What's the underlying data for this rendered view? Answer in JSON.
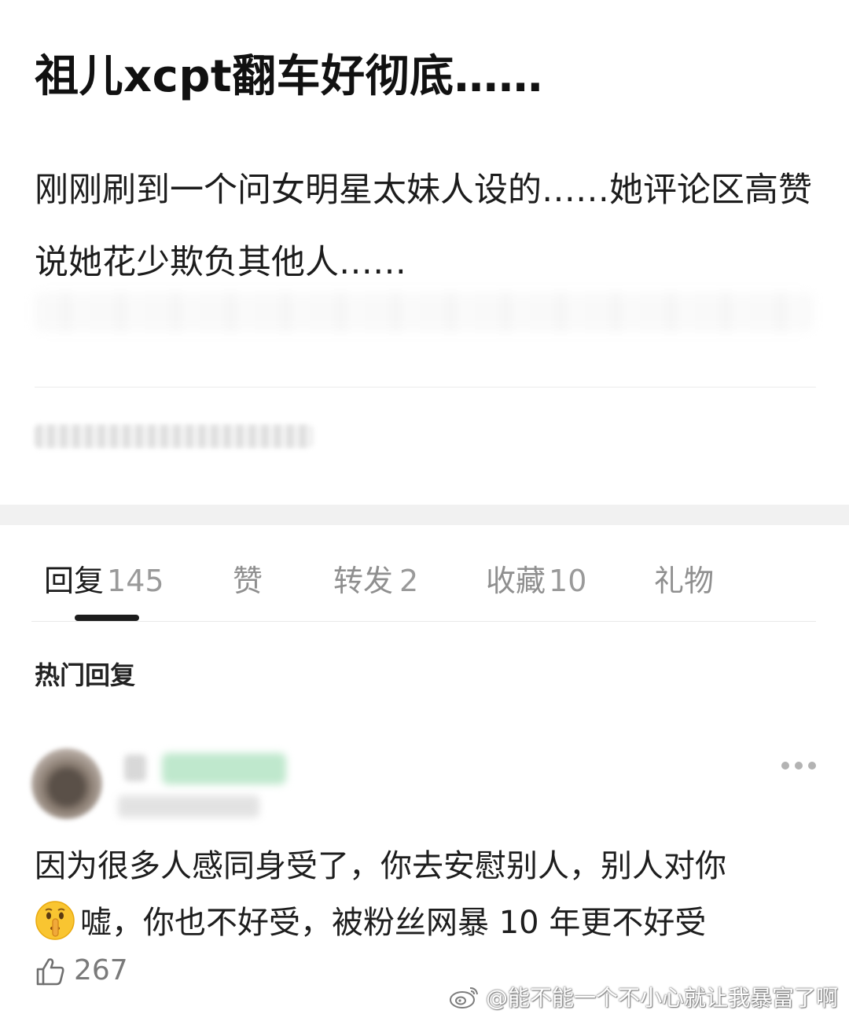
{
  "post": {
    "title": "祖儿xcpt翻车好彻底……",
    "body": "刚刚刷到一个问女明星太妹人设的……她评论区高赞说她花少欺负其他人……"
  },
  "tabs": [
    {
      "label": "回复",
      "count": "145"
    },
    {
      "label": "赞",
      "count": ""
    },
    {
      "label": "转发",
      "count": "2"
    },
    {
      "label": "收藏",
      "count": "10"
    },
    {
      "label": "礼物",
      "count": ""
    }
  ],
  "active_tab": "回复",
  "hot_replies": {
    "heading": "热门回复",
    "comment": {
      "line1": "因为很多人感同身受了，你去安慰别人，别人对你",
      "line2": "嘘，你也不好受，被粉丝网暴 10 年更不好受",
      "emoji": "shushing-face-icon",
      "likes": "267"
    }
  },
  "watermark": {
    "text": "@能不能一个不小心就让我暴富了啊",
    "icon": "weibo-logo-icon"
  },
  "colors": {
    "title": "#111111",
    "tab_active": "#1b1b1b",
    "tab_inactive": "#8f8f8f",
    "section_gap": "#f1f1f1",
    "like_count": "#7a7a7a"
  }
}
